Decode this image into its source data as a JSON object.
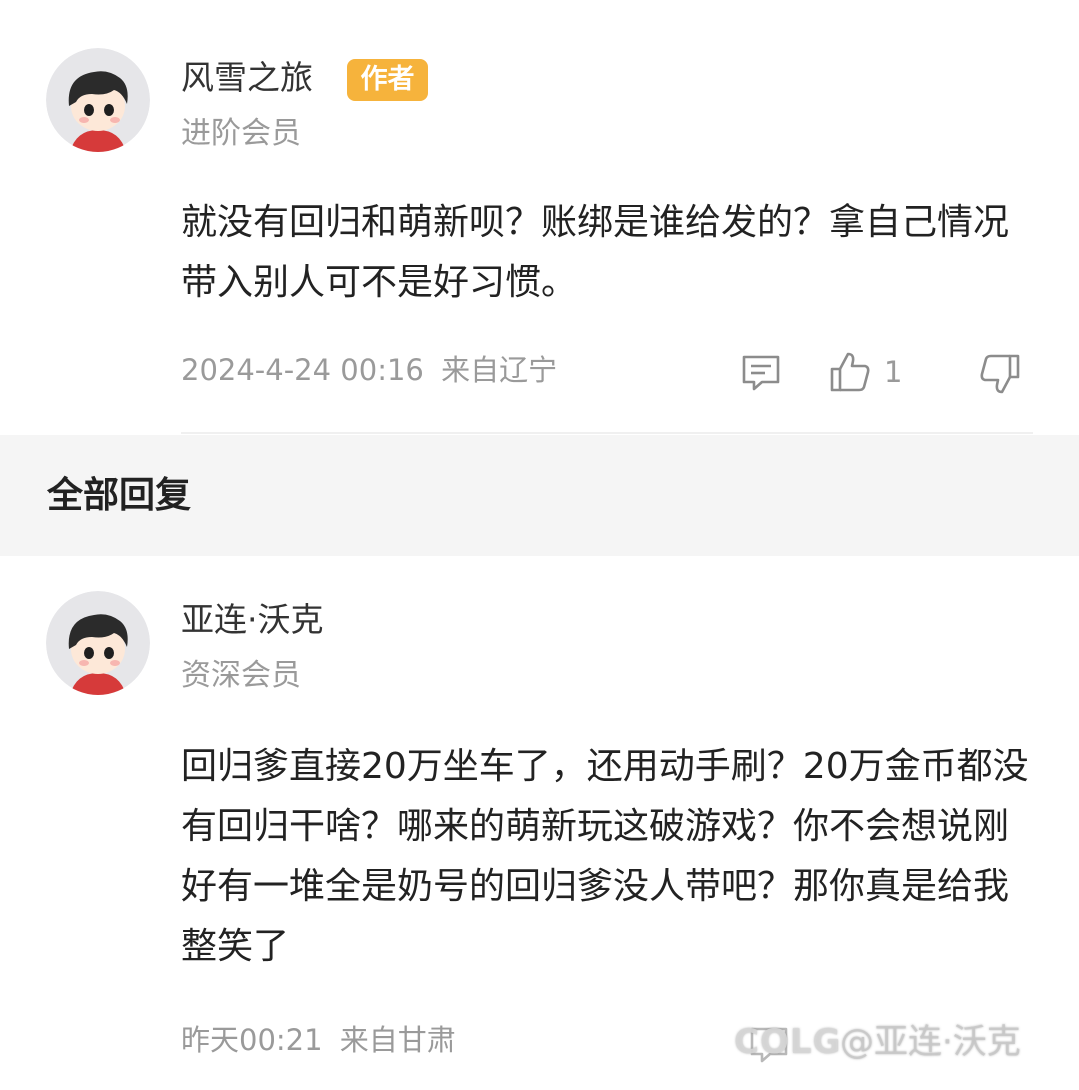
{
  "comment": {
    "author": {
      "name": "风雪之旅",
      "badge": "作者",
      "member_level": "进阶会员",
      "avatar": "avatar-cartoon-boy"
    },
    "text": "就没有回归和萌新呗？账绑是谁给发的？拿自己情况带入别人可不是好习惯。",
    "timestamp": "2024-4-24 00:16",
    "location": "来自辽宁",
    "actions": {
      "reply_icon": "comment-icon",
      "like_icon": "thumbs-up-icon",
      "like_count": "1",
      "dislike_icon": "thumbs-down-icon"
    }
  },
  "replies_section": {
    "title": "全部回复"
  },
  "reply": {
    "author": {
      "name": "亚连·沃克",
      "member_level": "资深会员",
      "avatar": "avatar-cartoon-boy"
    },
    "text": "回归爹直接20万坐车了，还用动手刷？20万金币都没有回归干啥？哪来的萌新玩这破游戏？你不会想说刚好有一堆全是奶号的回归爹没人带吧？那你真是给我整笑了",
    "timestamp": "昨天00:21",
    "location": "来自甘肃"
  },
  "watermark": {
    "logo": "COLG",
    "handle": "@亚连·沃克"
  },
  "colors": {
    "badge": "#f6b33c",
    "section_band": "#f5f5f5",
    "muted_text": "#9a9a9a"
  }
}
